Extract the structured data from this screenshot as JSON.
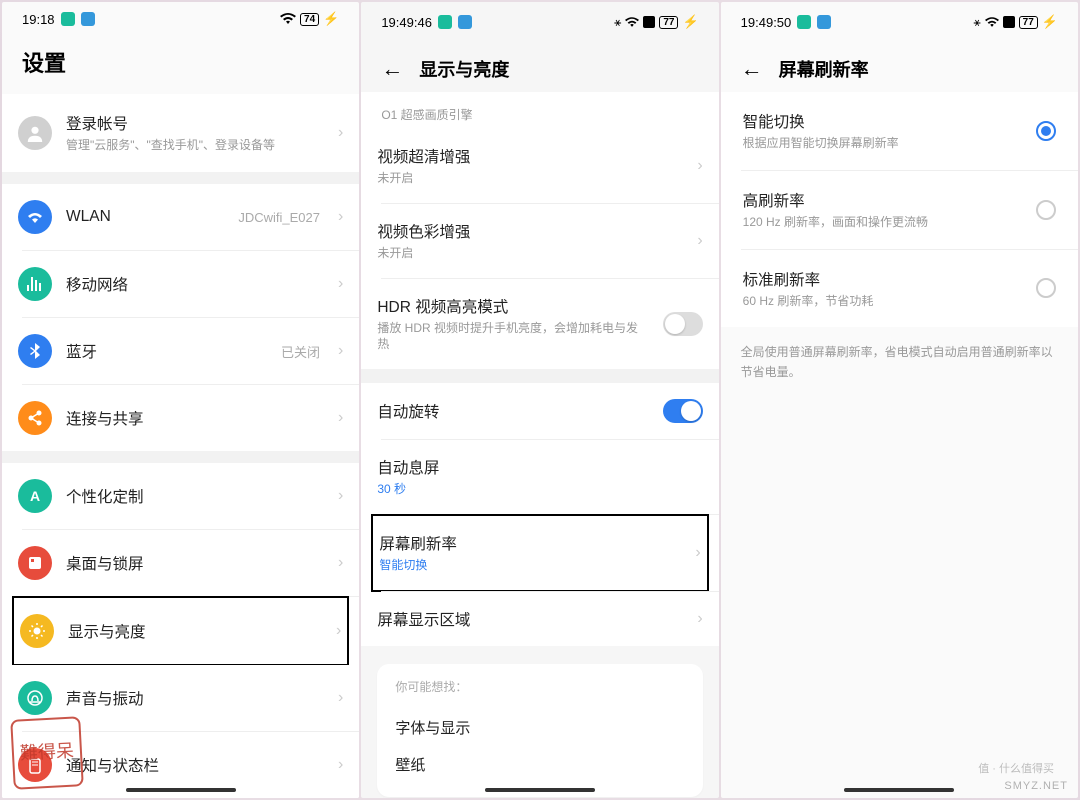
{
  "phone1": {
    "time": "19:18",
    "battery": "74",
    "title": "设置",
    "account": {
      "title": "登录帐号",
      "sub": "管理\"云服务\"、\"查找手机\"、登录设备等"
    },
    "items": [
      {
        "icon": "wifi",
        "color": "#2f7ef0",
        "title": "WLAN",
        "value": "JDCwifi_E027"
      },
      {
        "icon": "mobile",
        "color": "#1abc9c",
        "title": "移动网络",
        "value": ""
      },
      {
        "icon": "bluetooth",
        "color": "#2f7ef0",
        "title": "蓝牙",
        "value": "已关闭"
      },
      {
        "icon": "share",
        "color": "#ff8c1a",
        "title": "连接与共享",
        "value": ""
      }
    ],
    "items2": [
      {
        "icon": "palette",
        "color": "#1abc9c",
        "title": "个性化定制"
      },
      {
        "icon": "desktop",
        "color": "#e74c3c",
        "title": "桌面与锁屏"
      },
      {
        "icon": "brightness",
        "color": "#f5b921",
        "title": "显示与亮度",
        "highlight": true
      },
      {
        "icon": "sound",
        "color": "#1abc9c",
        "title": "声音与振动"
      },
      {
        "icon": "notification",
        "color": "#e74c3c",
        "title": "通知与状态栏"
      }
    ],
    "stamp": "難得呆"
  },
  "phone2": {
    "time": "19:49:46",
    "battery": "77",
    "title": "显示与亮度",
    "section_label": "O1 超感画质引擎",
    "rows": [
      {
        "title": "视频超清增强",
        "sub": "未开启",
        "type": "arrow"
      },
      {
        "title": "视频色彩增强",
        "sub": "未开启",
        "type": "arrow"
      },
      {
        "title": "HDR 视频高亮模式",
        "sub": "播放 HDR 视频时提升手机亮度，会增加耗电与发热",
        "type": "toggle",
        "on": false
      }
    ],
    "rows2": [
      {
        "title": "自动旋转",
        "type": "toggle",
        "on": true
      },
      {
        "title": "自动息屏",
        "sub": "30 秒",
        "sublink": true,
        "type": "plain"
      },
      {
        "title": "屏幕刷新率",
        "sub": "智能切换",
        "sublink": true,
        "type": "arrow",
        "highlight": true
      },
      {
        "title": "屏幕显示区域",
        "type": "arrow"
      }
    ],
    "suggest": {
      "hint": "你可能想找：",
      "links": [
        "字体与显示",
        "壁纸"
      ]
    }
  },
  "phone3": {
    "time": "19:49:50",
    "battery": "77",
    "title": "屏幕刷新率",
    "options": [
      {
        "title": "智能切换",
        "sub": "根据应用智能切换屏幕刷新率",
        "selected": true
      },
      {
        "title": "高刷新率",
        "sub": "120 Hz 刷新率，画面和操作更流畅",
        "selected": false
      },
      {
        "title": "标准刷新率",
        "sub": "60 Hz 刷新率，节省功耗",
        "selected": false
      }
    ],
    "note": "全局使用普通屏幕刷新率，省电模式自动启用普通刷新率以节省电量。"
  },
  "watermark": "SMYZ.NET",
  "watermark2": "值 · 什么值得买"
}
